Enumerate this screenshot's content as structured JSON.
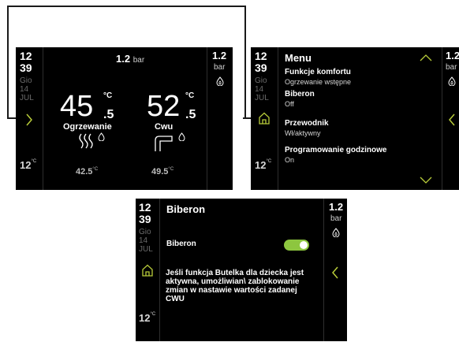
{
  "clock": {
    "hour": "12",
    "minute": "39"
  },
  "date": {
    "weekday": "Gio",
    "day": "14",
    "month": "JUL"
  },
  "outdoor_temp": {
    "value": "12",
    "unit": "°C"
  },
  "pressure": {
    "value": "1.2",
    "unit": "bar"
  },
  "home": {
    "heating": {
      "temp_int": "45",
      "temp_dec": ".5",
      "unit": "°C",
      "label": "Ogrzewanie",
      "setpoint": "42.5",
      "setpoint_unit": "°C"
    },
    "dhw": {
      "temp_int": "52",
      "temp_dec": ".5",
      "unit": "°C",
      "label": "Cwu",
      "setpoint": "49.5",
      "setpoint_unit": "°C"
    }
  },
  "menu": {
    "title": "Menu",
    "items": [
      {
        "label": "Funkcje komfortu",
        "value": "Ogrzewanie wstępne"
      },
      {
        "label": "Biberon",
        "value": "Off"
      },
      {
        "label": "Przewodnik",
        "value": "Wł/aktywny"
      },
      {
        "label": "Programowanie godzinowe",
        "value": "On"
      }
    ]
  },
  "biberon": {
    "title": "Biberon",
    "toggle_label": "Biberon",
    "toggle_on": true,
    "description": "Jeśli funkcja Butelka dla dziecka jest aktywna, umożliwian\\ zablokowanie zmian w nastawie wartości zadanej CWU"
  },
  "colors": {
    "accent": "#9acd32",
    "toggle": "#8dc63f",
    "screen_bg": "#000000"
  },
  "icons": [
    "chevron-right-icon",
    "chevron-left-icon",
    "chevron-up-icon",
    "chevron-down-icon",
    "home-icon",
    "flame-icon",
    "radiator-icon",
    "faucet-icon"
  ]
}
